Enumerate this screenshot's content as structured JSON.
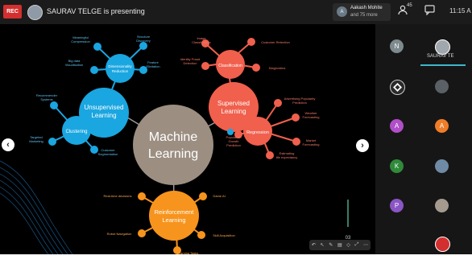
{
  "topbar": {
    "rec_label": "REC",
    "presenting_text": "SAURAV TELGE is presenting",
    "participants_line1": "Aakash Mohite",
    "participants_line2": "and 75 more",
    "participants_initial": "A",
    "participant_count": "45",
    "time": "11:15 A"
  },
  "slide": {
    "center": "Machine Learning",
    "unsupervised": {
      "title": "Unsupervised Learning",
      "dimred": "Dimensionality Reduction",
      "dimred_leaves": [
        "Meaningful Compression",
        "Structure Discovery",
        "Big data Visualisation",
        "Feature Elicitation"
      ],
      "clustering": "Clustering",
      "clustering_leaves": [
        "Recommender Systems",
        "Targeted Marketing",
        "Customer Segmentation"
      ]
    },
    "supervised": {
      "title": "Supervised Learning",
      "classification": "Classification",
      "classification_leaves": [
        "Image Classification",
        "Customer Retention",
        "Identity Fraud Detection",
        "Diagnostics"
      ],
      "regression": "Regression",
      "regression_leaves": [
        "Advertising Popularity Prediction",
        "Weather Forecasting",
        "Market Forecasting",
        "Estimating life expectancy",
        "Population Growth Prediction"
      ]
    },
    "reinforcement": {
      "title": "Reinforcement Learning",
      "leaves": [
        "Real-time decisions",
        "Game AI",
        "Robot Navigation",
        "Skill Acquisition",
        "Learning Tasks"
      ]
    },
    "page_number": "03"
  },
  "participants": {
    "self_label": "SAURAV TE",
    "initials": [
      "N",
      "A",
      "A",
      "K",
      "P"
    ]
  },
  "colors": {
    "unsupervised": "#1aa6e0",
    "supervised": "#f0604d",
    "reinforcement": "#f7941d",
    "center": "#9c8f82"
  },
  "icons": [
    "video-icon",
    "chat-icon",
    "people-icon",
    "prev-arrow-icon",
    "next-arrow-icon"
  ]
}
